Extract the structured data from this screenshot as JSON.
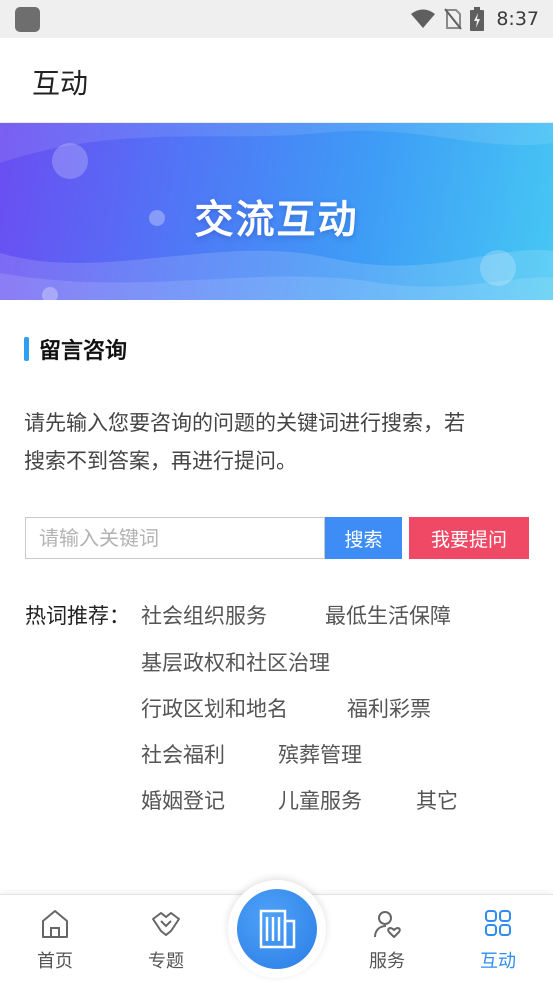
{
  "status_bar": {
    "time": "8:37",
    "icons": [
      "app-icon",
      "wifi-icon",
      "no-sim-icon",
      "battery-charging-icon"
    ]
  },
  "header": {
    "title": "互动"
  },
  "banner": {
    "title": "交流互动"
  },
  "section": {
    "title": "留言咨询"
  },
  "description": {
    "line1": "请先输入您要咨询的问题的关键词进行搜索，若",
    "line2": "搜索不到答案，再进行提问。"
  },
  "search": {
    "placeholder": "请输入关键词",
    "value": "",
    "search_label": "搜索",
    "ask_label": "我要提问"
  },
  "hot_words": {
    "label": "热词推荐：",
    "tags": [
      "社会组织服务",
      "最低生活保障",
      "基层政权和社区治理",
      "行政区划和地名",
      "福利彩票",
      "社会福利",
      "殡葬管理",
      "婚姻登记",
      "儿童服务",
      "其它"
    ]
  },
  "bottom_nav": {
    "items": [
      {
        "label": "首页",
        "icon": "home-icon"
      },
      {
        "label": "专题",
        "icon": "handshake-icon"
      },
      {
        "label": "",
        "icon": "building-icon"
      },
      {
        "label": "服务",
        "icon": "user-heart-icon"
      },
      {
        "label": "互动",
        "icon": "grid-icon",
        "active": true
      }
    ]
  },
  "colors": {
    "accent": "#2f8df2",
    "search_button": "#3e8cf6",
    "ask_button": "#ef4966",
    "section_bar": "#2f9ff2",
    "banner_gradient_start": "#6b4df2",
    "banner_gradient_end": "#46c8f4"
  }
}
